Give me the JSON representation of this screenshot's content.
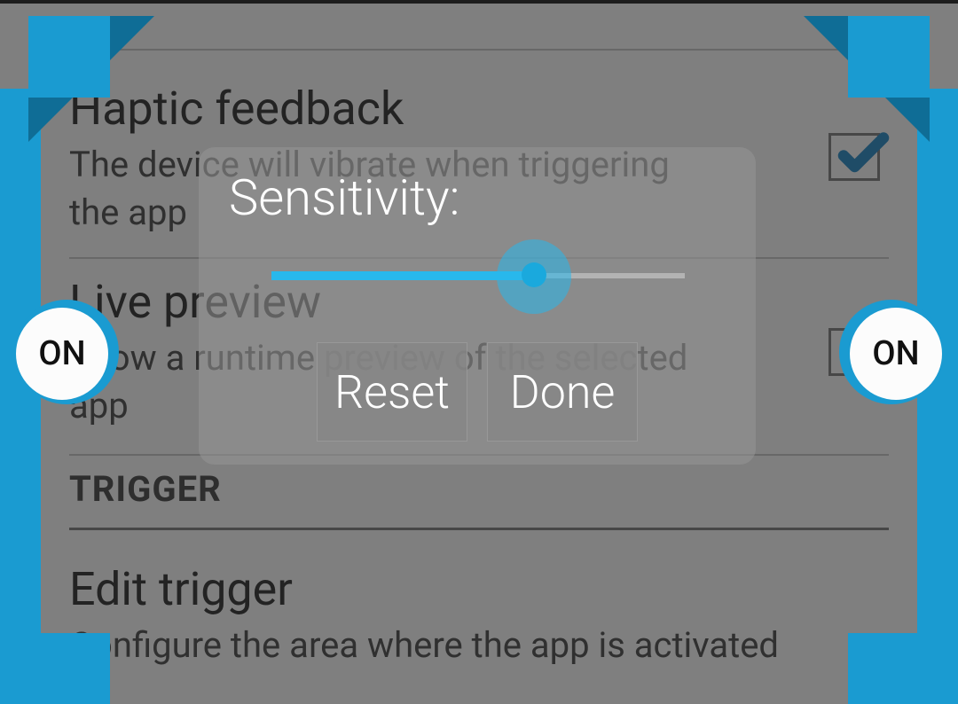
{
  "settings": {
    "haptic": {
      "title": "Haptic feedback",
      "subtitle": "The device will vibrate when triggering the app",
      "checked": true
    },
    "live": {
      "title": "Live preview",
      "subtitle": "Show a runtime preview of the selected app",
      "checked": false
    },
    "section_trigger": "TRIGGER",
    "edit": {
      "title": "Edit trigger",
      "subtitle": "Configure the area where the app is activated"
    }
  },
  "dialog": {
    "title": "Sensitivity:",
    "slider_value": 55,
    "buttons": {
      "reset": "Reset",
      "done": "Done"
    }
  },
  "triggers": {
    "left_label": "ON",
    "right_label": "ON"
  },
  "colors": {
    "accent": "#1a9bd1",
    "accent_dark": "#0f6d96",
    "slider": "#28b8ec"
  }
}
